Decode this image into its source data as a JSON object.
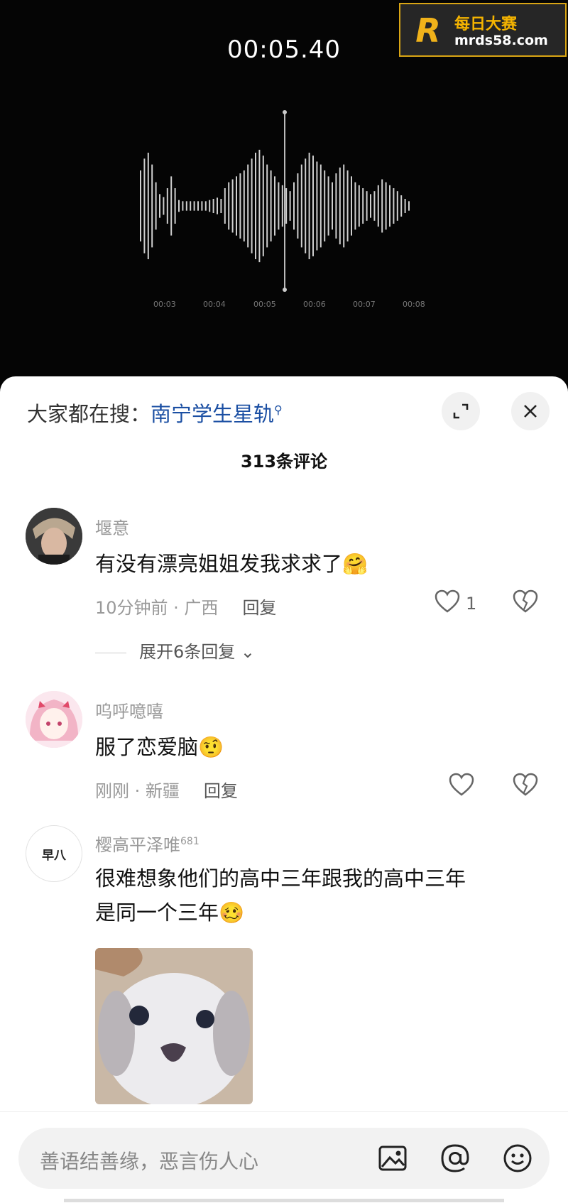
{
  "video": {
    "timer": "00:05.40",
    "ticks": [
      "00:03",
      "00:04",
      "00:05",
      "00:06",
      "00:07",
      "00:08"
    ],
    "logo": {
      "mark": "R",
      "line1": "每日大赛",
      "line2": "mrds58.com"
    }
  },
  "sheet": {
    "search_prefix": "大家都在搜：",
    "search_keyword": "南宁学生星轨",
    "comment_count": "313条评论"
  },
  "comments": [
    {
      "user": "堰意",
      "text": "有没有漂亮姐姐发我求求了",
      "time_loc": "10分钟前 · 广西",
      "reply": "回复",
      "likes": "1",
      "expand": "展开6条回复"
    },
    {
      "user": "呜呼噫嘻",
      "text": "服了恋爱脑",
      "time_loc": "刚刚 · 新疆",
      "reply": "回复",
      "likes": ""
    },
    {
      "user": "樱高平泽唯",
      "user_badge": "681",
      "avatar_text": "早八",
      "text_line1": "很难想象他们的高中三年跟我的高中三年",
      "text_line2": "是同一个三年"
    }
  ],
  "input": {
    "placeholder": "善语结善缘，恶言伤人心"
  },
  "colors": {
    "accent_link": "#1b4fa3",
    "logo_gold": "#f0b21a"
  }
}
